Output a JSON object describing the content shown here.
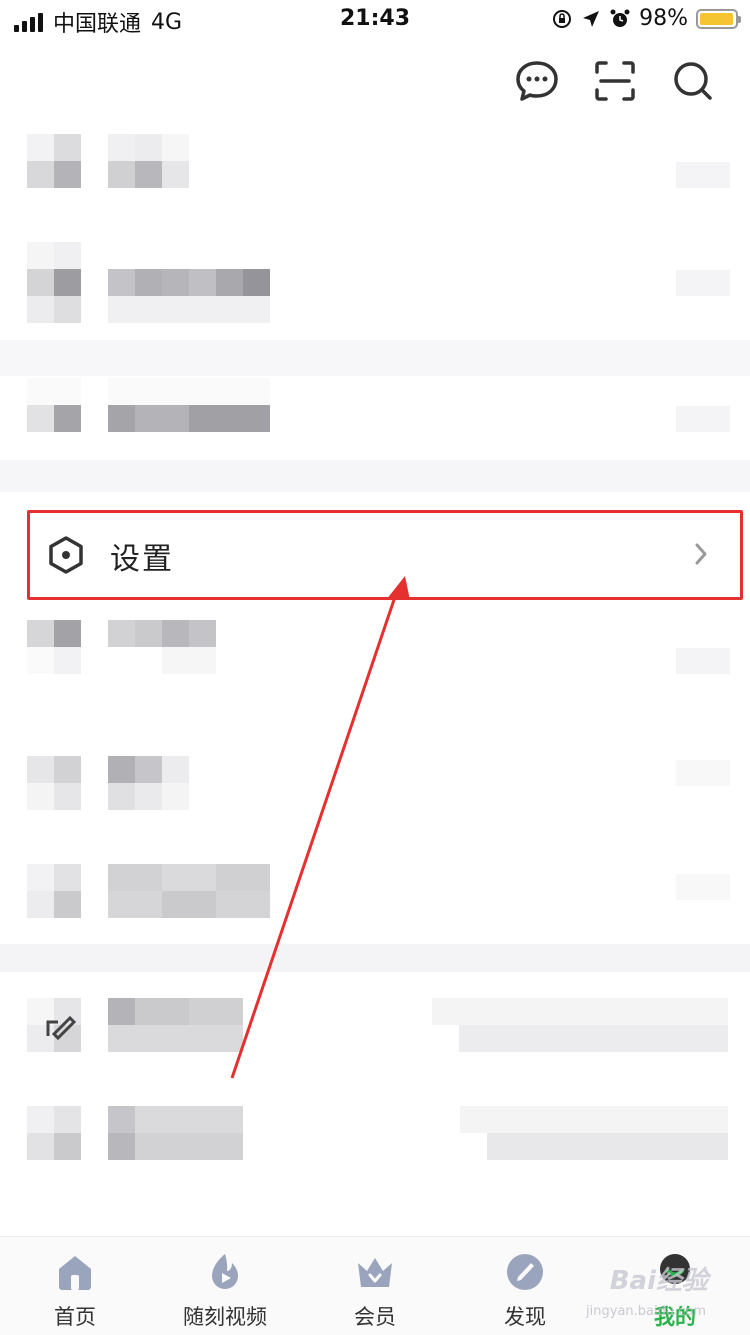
{
  "status_bar": {
    "carrier": "中国联通",
    "network": "4G",
    "time": "21:43",
    "battery": "98%",
    "battery_level": 0.98,
    "battery_color": "#f5c431"
  },
  "header": {
    "icons": [
      "message-icon",
      "scan-icon",
      "search-icon"
    ]
  },
  "settings": {
    "label": "设置",
    "icon": "hexagon-settings-icon",
    "highlight_color": "#e53030"
  },
  "annotation": {
    "arrow_color": "#e53030"
  },
  "tab_bar": {
    "tabs": [
      {
        "label": "首页",
        "icon": "home-icon"
      },
      {
        "label": "随刻视频",
        "icon": "flame-icon"
      },
      {
        "label": "会员",
        "icon": "crown-icon"
      },
      {
        "label": "发现",
        "icon": "compass-icon"
      },
      {
        "label": "我的",
        "icon": "avatar-icon",
        "active": true
      }
    ],
    "active_color": "#2bb24c"
  },
  "watermark": {
    "brand": "Bai经验",
    "site": "jingyan.baidu.com"
  }
}
